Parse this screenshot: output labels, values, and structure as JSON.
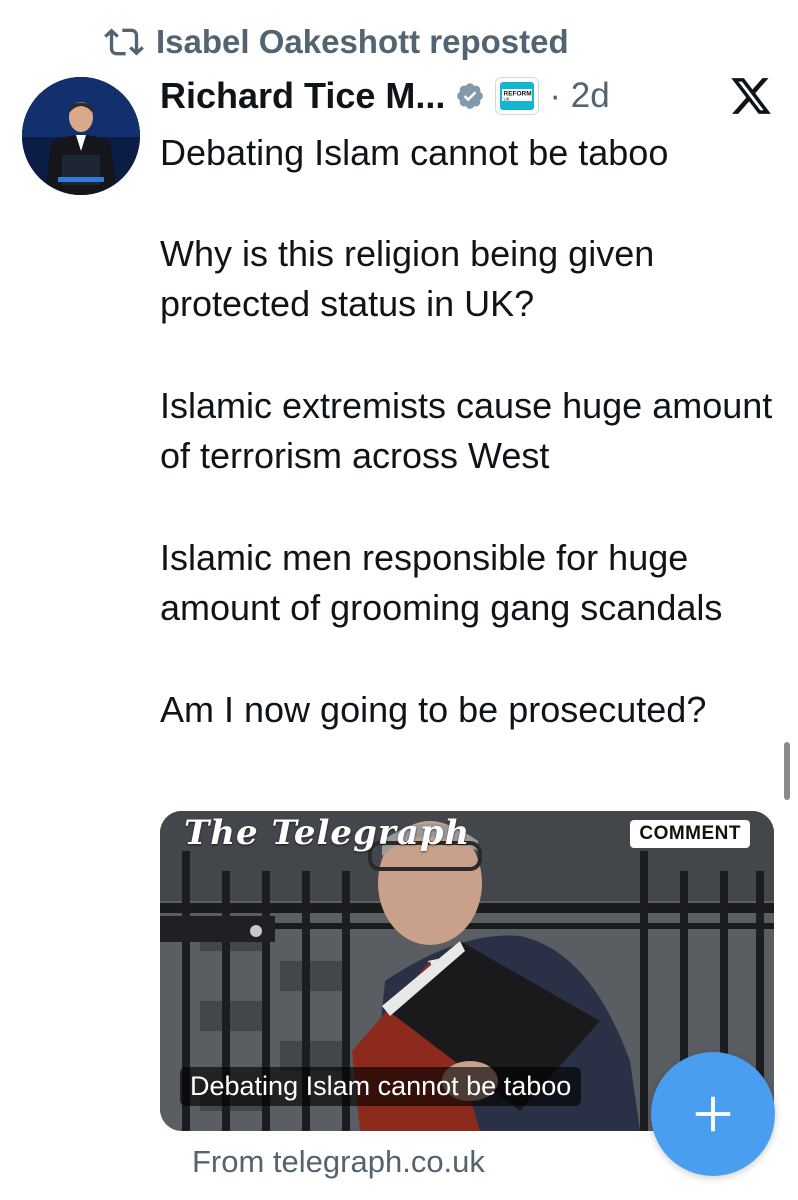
{
  "repost": {
    "icon": "repost-icon",
    "label": "Isabel Oakeshott reposted"
  },
  "tweet": {
    "author_name": "Richard Tice M...",
    "verified_icon": "verified-badge-icon",
    "affiliation_badge": "reform-uk-badge",
    "affiliation_text_line1": "REFORM",
    "affiliation_text_line2": "UK",
    "timestamp": "· 2d",
    "paragraphs": [
      "Debating Islam cannot be taboo",
      "Why is this religion being given protected status in UK?",
      "Islamic extremists cause huge amount of terrorism across West",
      "Islamic men responsible for huge amount of grooming gang scandals",
      "Am I now going to be prosecuted?"
    ]
  },
  "link_card": {
    "masthead": "The Telegraph",
    "badge": "COMMENT",
    "caption": "Debating Islam cannot be taboo",
    "source": "From telegraph.co.uk"
  },
  "compose_button": {
    "icon": "plus-icon",
    "color": "#4a9ef0"
  },
  "x_logo": "x-logo-icon"
}
